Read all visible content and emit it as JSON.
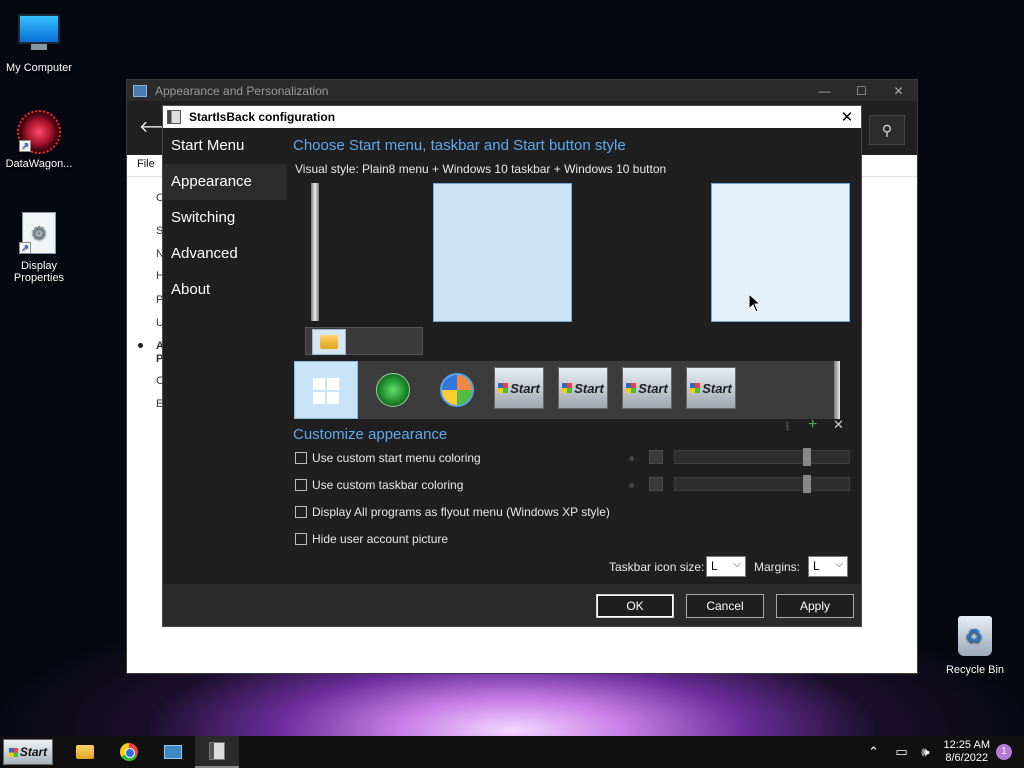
{
  "desktop": {
    "icons": [
      {
        "label": "My Computer"
      },
      {
        "label": "DataWagon..."
      },
      {
        "label": "Display Properties"
      },
      {
        "label": "Recycle Bin"
      }
    ]
  },
  "bg_window": {
    "title": "Appearance and Personalization",
    "menu_file": "File",
    "side_letters": [
      "C",
      "S",
      "N",
      "H",
      "P",
      "U",
      "A",
      "P",
      "C",
      "E"
    ]
  },
  "dialog": {
    "title": "StartIsBack configuration",
    "nav": [
      "Start Menu",
      "Appearance",
      "Switching",
      "Advanced",
      "About"
    ],
    "active_nav": "Appearance",
    "heading1": "Choose Start menu, taskbar and Start button style",
    "visual_style_label": "Visual style:",
    "visual_style_value": "Plain8 menu + Windows 10 taskbar + Windows 10 button",
    "start_button_labels": [
      "Start",
      "Start",
      "Start",
      "Start"
    ],
    "heading2": "Customize appearance",
    "checks": [
      "Use custom start menu coloring",
      "Use custom taskbar coloring",
      "Display All programs as flyout menu (Windows XP style)",
      "Hide user account picture"
    ],
    "taskbar_icon_size_label": "Taskbar icon size:",
    "taskbar_icon_size_value": "L",
    "margins_label": "Margins:",
    "margins_value": "L",
    "ok": "OK",
    "cancel": "Cancel",
    "apply": "Apply"
  },
  "taskbar": {
    "start_label": "Start",
    "time": "12:25 AM",
    "date": "8/6/2022",
    "notification_count": "1"
  },
  "colors": {
    "accent_heading": "#5fa9f0",
    "dialog_bg": "#1f1f1f",
    "preview_fill": "#cce4f7"
  }
}
